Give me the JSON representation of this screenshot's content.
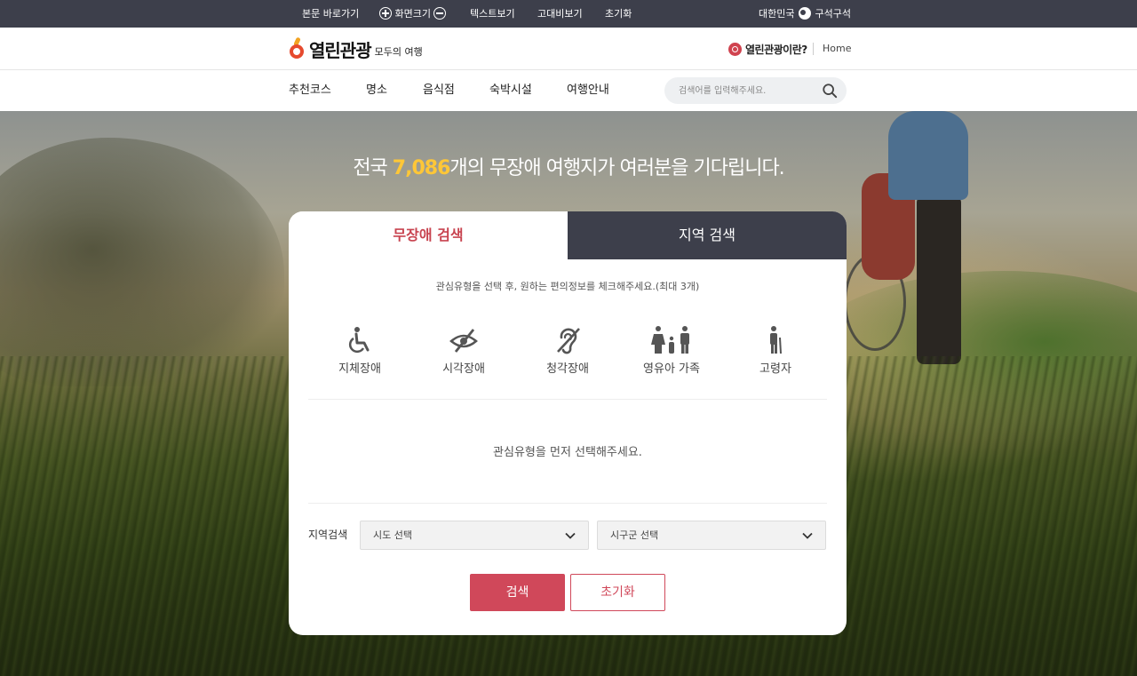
{
  "topbar": {
    "skip_to_content": "본문 바로가기",
    "font_size": "화면크기",
    "text_view": "텍스트보기",
    "high_contrast": "고대비보기",
    "reset": "초기화",
    "org_prefix": "대한민국",
    "org_suffix": "구석구석"
  },
  "header": {
    "logo_text": "열린관광",
    "logo_sub": "모두의 여행",
    "about_link": "열린관광이란?",
    "home_link": "Home"
  },
  "nav": {
    "items": [
      "추천코스",
      "명소",
      "음식점",
      "숙박시설",
      "여행안내"
    ],
    "search_placeholder": "검색어를 입력해주세요."
  },
  "hero": {
    "title_prefix": "전국 ",
    "count": "7,086",
    "title_suffix": "개의 무장애 여행지가 여러분을 기다립니다."
  },
  "panel": {
    "tabs": [
      "무장애 검색",
      "지역 검색"
    ],
    "active_tab": 0,
    "guide_text": "관심유형을 선택 후, 원하는 편의정보를 체크해주세요.(최대 3개)",
    "types": [
      {
        "label": "지체장애",
        "icon": "wheelchair-icon"
      },
      {
        "label": "시각장애",
        "icon": "visual-impairment-icon"
      },
      {
        "label": "청각장애",
        "icon": "hearing-impairment-icon"
      },
      {
        "label": "영유아 가족",
        "icon": "family-icon"
      },
      {
        "label": "고령자",
        "icon": "elderly-icon"
      }
    ],
    "empty_message": "관심유형을 먼저 선택해주세요.",
    "region_label": "지역검색",
    "province_select": "시도 선택",
    "district_select": "시구군 선택",
    "search_button": "검색",
    "reset_button": "초기화"
  },
  "colors": {
    "topbar_bg": "#3d3f4b",
    "accent": "#d0485a",
    "highlight_number": "#ffc737"
  }
}
